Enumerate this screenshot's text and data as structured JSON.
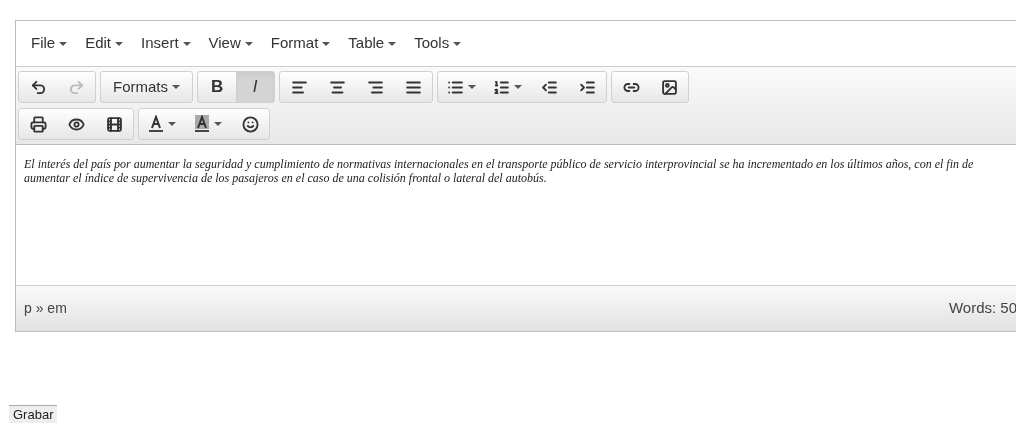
{
  "menubar": [
    {
      "label": "File"
    },
    {
      "label": "Edit"
    },
    {
      "label": "Insert"
    },
    {
      "label": "View"
    },
    {
      "label": "Format"
    },
    {
      "label": "Table"
    },
    {
      "label": "Tools"
    }
  ],
  "toolbar_rows": [
    [
      [
        {
          "kind": "undo",
          "disabled": false
        },
        {
          "kind": "redo",
          "disabled": true
        }
      ],
      [
        {
          "kind": "dropdown",
          "label": "Formats"
        }
      ],
      [
        {
          "kind": "bold",
          "label": "B",
          "selected": false
        },
        {
          "kind": "italic",
          "label": "I",
          "selected": true
        }
      ],
      [
        {
          "kind": "align-left"
        },
        {
          "kind": "align-center"
        },
        {
          "kind": "align-right"
        },
        {
          "kind": "align-justify"
        }
      ],
      [
        {
          "kind": "bullet-list"
        },
        {
          "kind": "numbered-list"
        },
        {
          "kind": "outdent"
        },
        {
          "kind": "indent"
        }
      ],
      [
        {
          "kind": "link"
        },
        {
          "kind": "image"
        }
      ]
    ],
    [
      [
        {
          "kind": "print"
        },
        {
          "kind": "preview"
        },
        {
          "kind": "media"
        }
      ],
      [
        {
          "kind": "text-color"
        },
        {
          "kind": "background-color"
        },
        {
          "kind": "emoticons"
        }
      ]
    ]
  ],
  "content": "El interés del país por aumentar la seguridad y cumplimiento de normativas internacionales en el transporte público de servicio interprovincial se ha incrementado en los últimos años, con el fin de aumentar el índice de supervivencia de los pasajeros en el caso de una colisión frontal o lateral del autobús.",
  "status_bar": {
    "path": "p » em",
    "word_count": "Words: 50"
  },
  "save_button": "Grabar"
}
